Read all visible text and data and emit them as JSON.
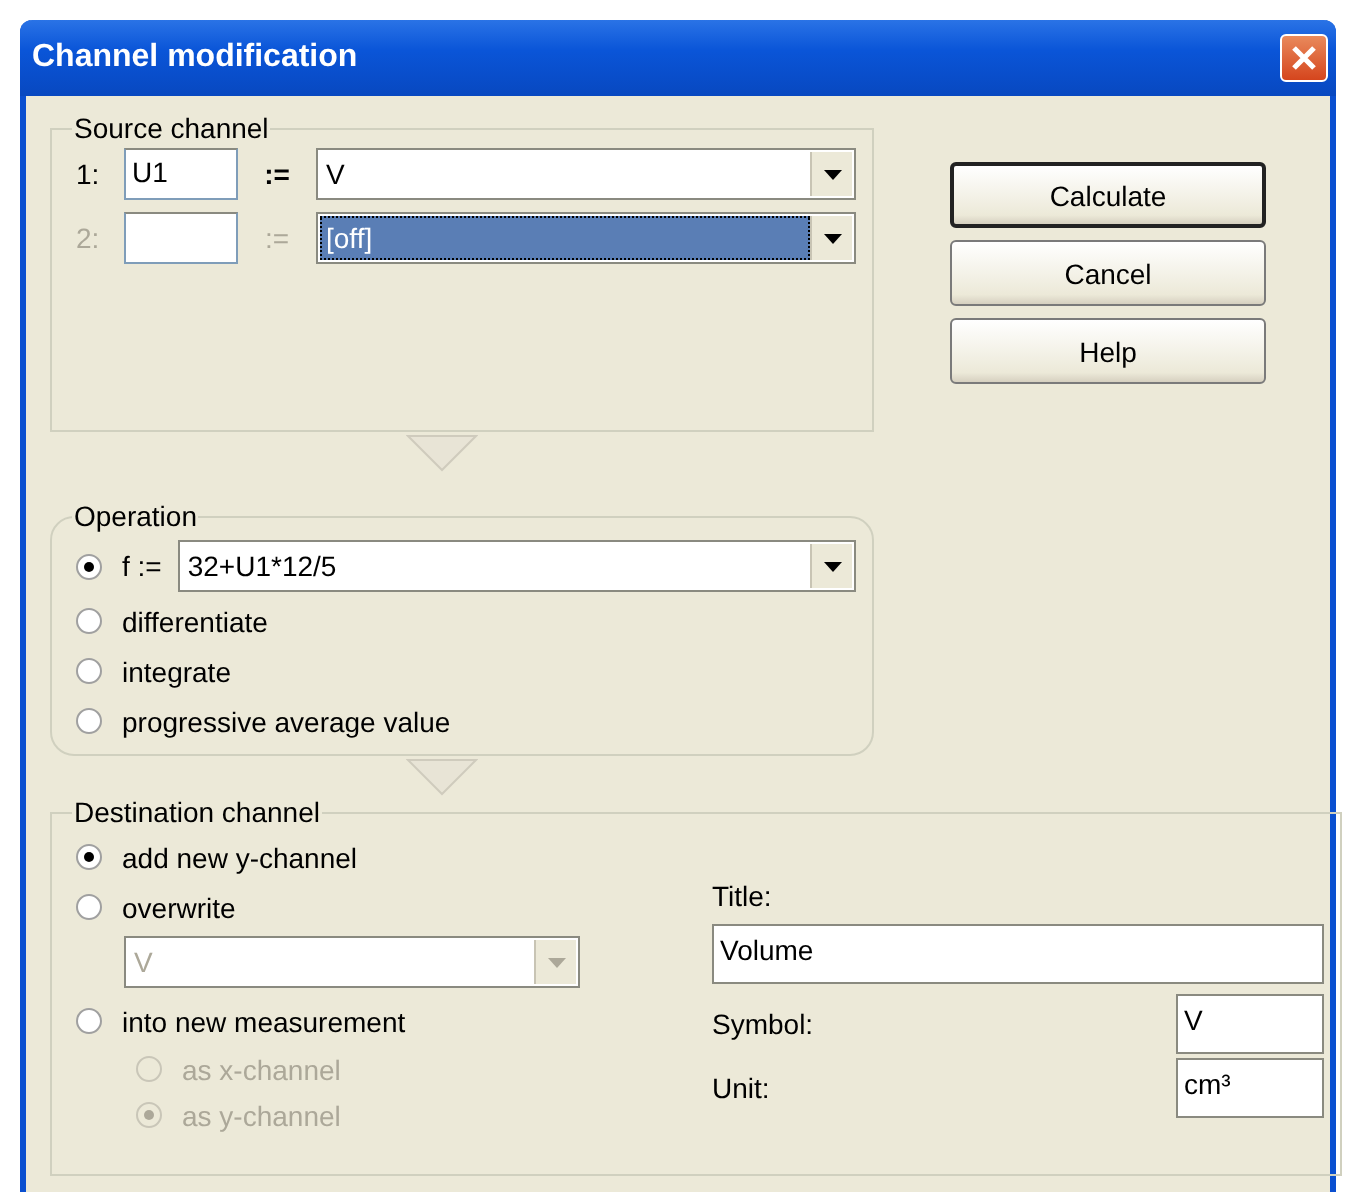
{
  "window": {
    "title": "Channel modification"
  },
  "source_channel": {
    "label": "Source channel",
    "rows": [
      {
        "index": "1:",
        "name": "U1",
        "assign": ":=",
        "value": "V",
        "disabled": false,
        "highlighted": false
      },
      {
        "index": "2:",
        "assign": ":=",
        "value": "[off]",
        "disabled": true,
        "highlighted": true
      }
    ]
  },
  "buttons": [
    {
      "label": "Calculate",
      "default": true
    },
    {
      "label": "Cancel",
      "default": false
    },
    {
      "label": "Help",
      "default": false
    }
  ],
  "operation": {
    "label": "Operation",
    "options": [
      {
        "kind": "formula",
        "label": "f :=",
        "value": "32+U1*12/5",
        "selected": true
      },
      {
        "kind": "plain",
        "label": "differentiate",
        "selected": false
      },
      {
        "kind": "plain",
        "label": "integrate",
        "selected": false
      },
      {
        "kind": "plain",
        "label": "progressive average value",
        "selected": false
      }
    ]
  },
  "destination": {
    "label": "Destination channel",
    "options": [
      {
        "kind": "plain",
        "label": "add new y-channel",
        "selected": true
      },
      {
        "kind": "target",
        "label": "overwrite",
        "selected": false,
        "target": {
          "value": "V",
          "disabled": true
        }
      },
      {
        "kind": "sub",
        "label": "into new measurement",
        "selected": false,
        "sub_options": [
          {
            "label": "as x-channel",
            "selected": false,
            "disabled": true
          },
          {
            "label": "as y-channel",
            "selected": true,
            "disabled": true
          }
        ]
      }
    ],
    "title": {
      "label": "Title:",
      "value": "Volume"
    },
    "symbol": {
      "label": "Symbol:",
      "value": "V"
    },
    "unit": {
      "label": "Unit:",
      "value": "cm³"
    }
  }
}
